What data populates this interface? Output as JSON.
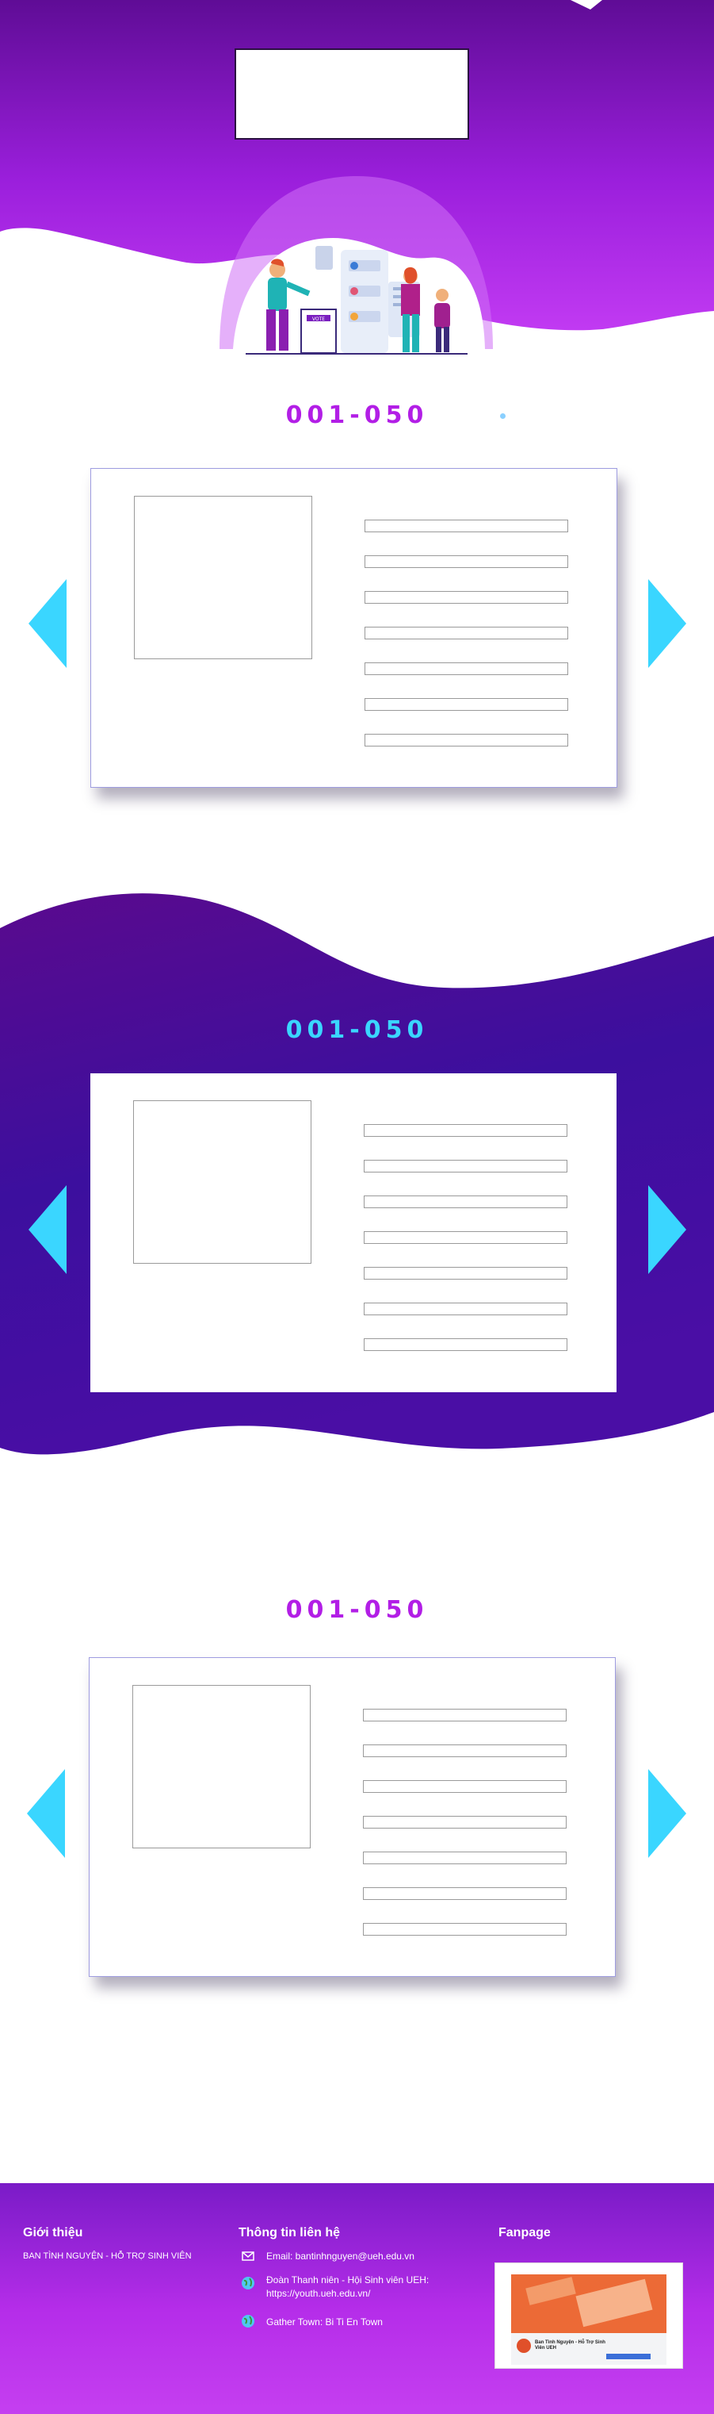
{
  "sections": [
    {
      "title": "001-050"
    },
    {
      "title": "001-050"
    },
    {
      "title": "001-050"
    }
  ],
  "illustration": {
    "ballot_label": "VOTE"
  },
  "footer": {
    "about": {
      "heading": "Giới thiệu",
      "text": "BAN TÌNH NGUYỆN - HỖ TRỢ SINH VIÊN"
    },
    "contact": {
      "heading": "Thông tin liên hệ",
      "items": [
        {
          "icon": "mail-icon",
          "text": "Email: bantinhnguyen@ueh.edu.vn"
        },
        {
          "icon": "globe-icon",
          "text": "Đoàn Thanh niên - Hội Sinh viên UEH: https://youth.ueh.edu.vn/"
        },
        {
          "icon": "globe-icon",
          "text": "Gather Town: Bi Ti En Town"
        }
      ]
    },
    "fanpage": {
      "heading": "Fanpage",
      "post_title": "Ban Tình Nguyện - Hỗ Trợ Sinh Viên UEH"
    }
  },
  "colors": {
    "purple_dark": "#5b0b93",
    "purple": "#9c1de0",
    "violet": "#b21ee6",
    "cyan": "#3ad6ff",
    "indigo": "#3a0fa2"
  }
}
